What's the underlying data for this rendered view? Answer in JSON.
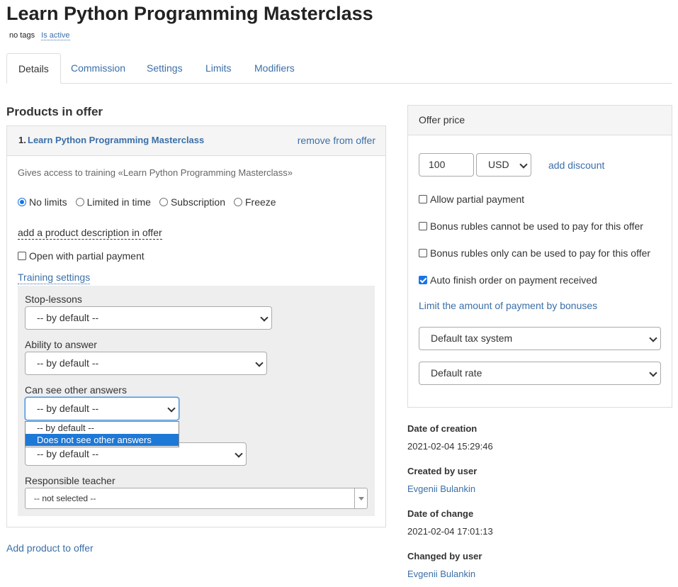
{
  "page": {
    "title": "Learn Python Programming Masterclass",
    "tags": {
      "no_tags": "no tags",
      "status": "Is active"
    }
  },
  "tabs": [
    {
      "label": "Details",
      "active": true
    },
    {
      "label": "Commission"
    },
    {
      "label": "Settings"
    },
    {
      "label": "Limits"
    },
    {
      "label": "Modifiers"
    }
  ],
  "products": {
    "heading": "Products in offer",
    "item": {
      "number": "1.",
      "name": "Learn Python Programming Masterclass",
      "remove_label": "remove from offer",
      "description": "Gives access to training «Learn Python Programming Masterclass»",
      "access_options": [
        "No limits",
        "Limited in time",
        "Subscription",
        "Freeze"
      ],
      "access_selected": "No limits",
      "add_description_label": "add a product description in offer",
      "open_partial_label": "Open with partial payment",
      "open_partial_checked": false,
      "training_settings_label": "Training settings",
      "fields": {
        "stop_lessons": {
          "label": "Stop-lessons",
          "value": "-- by default --"
        },
        "ability_to_answer": {
          "label": "Ability to answer",
          "value": "-- by default --"
        },
        "see_other_answers": {
          "label": "Can see other answers",
          "value": "-- by default --",
          "dropdown_open": true,
          "options": [
            "-- by default --",
            "Does not see other answers"
          ],
          "highlighted": "Does not see other answers"
        },
        "hidden_field": {
          "value": "-- by default --"
        },
        "responsible_teacher": {
          "label": "Responsible teacher",
          "value": "-- not selected --"
        }
      }
    },
    "add_product_label": "Add product to offer"
  },
  "offer_price": {
    "heading": "Offer price",
    "amount": "100",
    "currency": "USD",
    "add_discount_label": "add discount",
    "checkboxes": [
      {
        "label": "Allow partial payment",
        "checked": false
      },
      {
        "label": "Bonus rubles cannot be used to pay for this offer",
        "checked": false
      },
      {
        "label": "Bonus rubles only can be used to pay for this offer",
        "checked": false
      },
      {
        "label": "Auto finish order on payment received",
        "checked": true
      }
    ],
    "limit_bonus_label": "Limit the amount of payment by bonuses",
    "tax_system": "Default tax system",
    "rate": "Default rate"
  },
  "meta": {
    "created_label": "Date of creation",
    "created_value": "2021-02-04 15:29:46",
    "created_by_label": "Created by user",
    "created_by_value": "Evgenii Bulankin",
    "changed_label": "Date of change",
    "changed_value": "2021-02-04 17:01:13",
    "changed_by_label": "Changed by user",
    "changed_by_value": "Evgenii Bulankin"
  },
  "colors": {
    "link": "#3b6fa8",
    "highlight": "#1e78d6",
    "checkbox_checked": "#1a73e8",
    "panel_header": "#f5f5f5",
    "settings_box": "#eeeeee"
  }
}
